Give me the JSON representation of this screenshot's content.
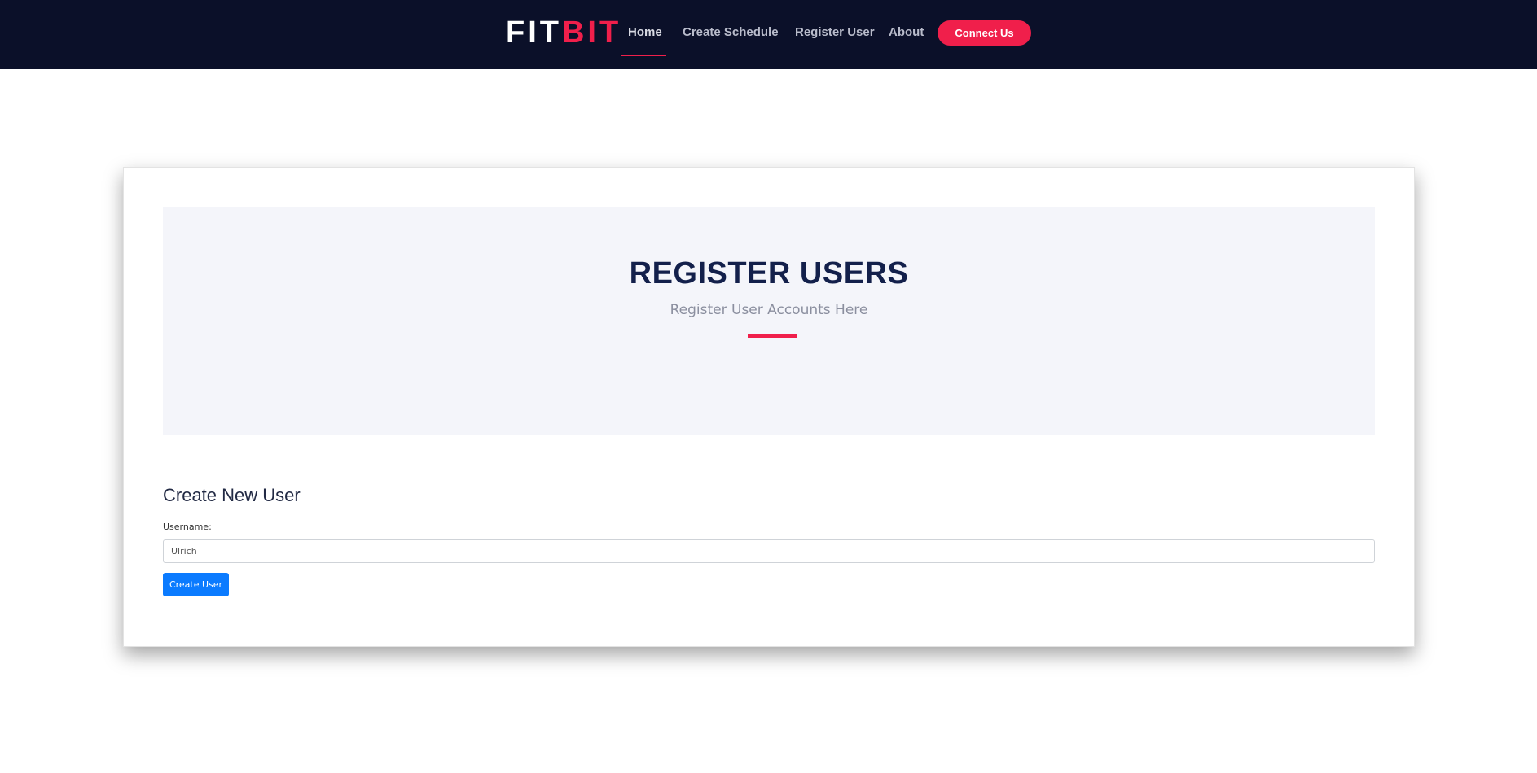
{
  "navbar": {
    "brand_part1": "FIT",
    "brand_part2": "BIT",
    "links": [
      {
        "label": "Home"
      },
      {
        "label": "Create Schedule"
      },
      {
        "label": "Register User"
      },
      {
        "label": "About"
      }
    ],
    "cta_label": "Connect Us"
  },
  "hero": {
    "title": "REGISTER USERS",
    "subtitle": "Register User Accounts Here"
  },
  "form": {
    "title": "Create New User",
    "username_label": "Username:",
    "username_value": "Ulrich",
    "submit_label": "Create User"
  },
  "colors": {
    "navbar_bg": "#0b1029",
    "accent": "#f01f4b",
    "hero_title": "#13204b",
    "primary_button": "#0b7bff",
    "hero_bg": "#f4f5fa"
  }
}
